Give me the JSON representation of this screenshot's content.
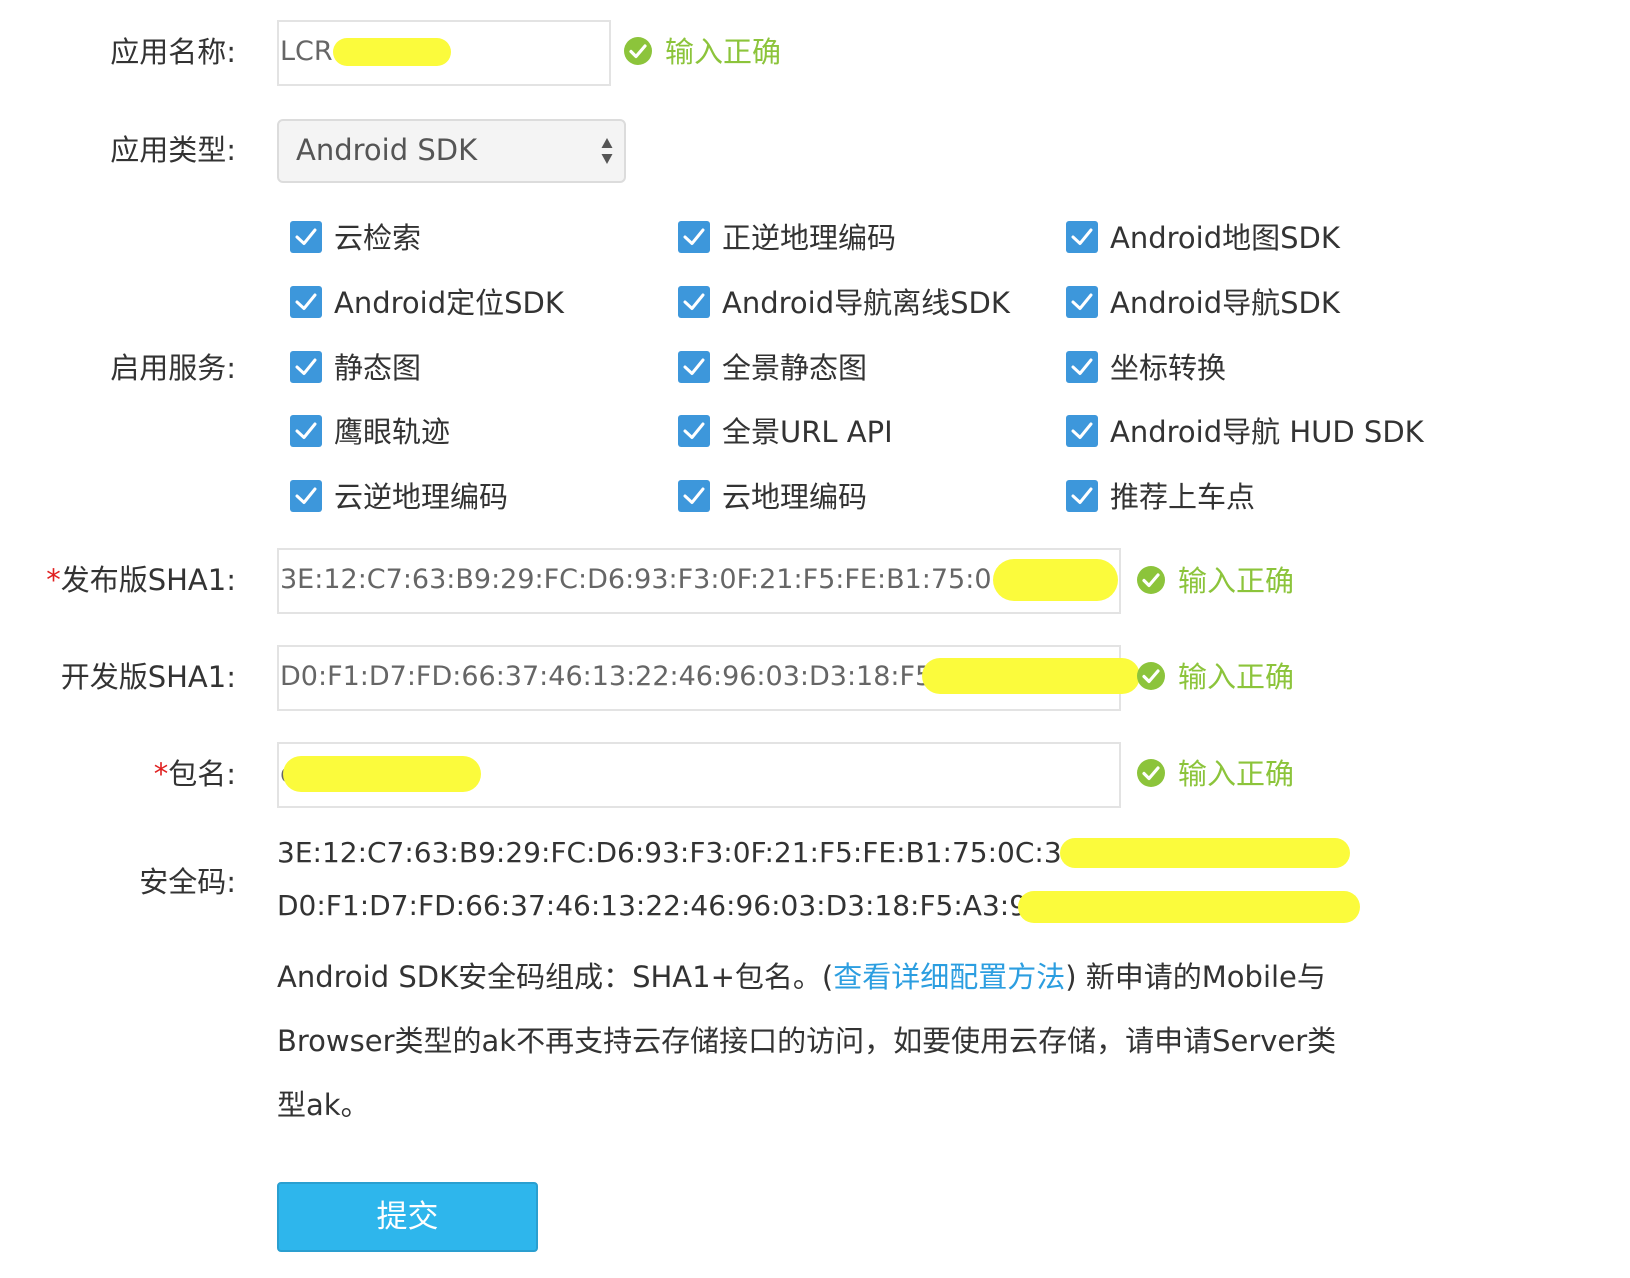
{
  "form": {
    "app_name_label": "应用名称:",
    "app_name_value": "LCR",
    "app_type_label": "应用类型:",
    "app_type_value": "Android SDK",
    "services_label": "启用服务:",
    "release_sha1_required": "*",
    "release_sha1_label": "发布版SHA1:",
    "release_sha1_value": "3E:12:C7:63:B9:29:FC:D6:93:F3:0F:21:F5:FE:B1:75:0",
    "dev_sha1_label": "开发版SHA1:",
    "dev_sha1_value": "D0:F1:D7:FD:66:37:46:13:22:46:96:03:D3:18:F5:",
    "package_required": "*",
    "package_label": "包名:",
    "package_value": "c",
    "valid_text": "输入正确"
  },
  "services": [
    "云检索",
    "正逆地理编码",
    "Android地图SDK",
    "Android定位SDK",
    "Android导航离线SDK",
    "Android导航SDK",
    "静态图",
    "全景静态图",
    "坐标转换",
    "鹰眼轨迹",
    "全景URL API",
    "Android导航 HUD SDK",
    "云逆地理编码",
    "云地理编码",
    "推荐上车点"
  ],
  "security": {
    "label": "安全码:",
    "line1": "3E:12:C7:63:B9:29:FC:D6:93:F3:0F:21:F5:FE:B1:75:0C:36.",
    "line2": "D0:F1:D7:FD:66:37:46:13:22:46:96:03:D3:18:F5:A3:95:",
    "desc_part1": "Android SDK安全码组成：SHA1+包名。(",
    "desc_link": "查看详细配置方法",
    "desc_part2": ") 新申请的Mobile与Browser类型的ak不再支持云存储接口的访问，如要使用云存储，请申请Server类型ak。"
  },
  "submit_label": "提交",
  "colors": {
    "valid": "#8cc43b",
    "checkbox": "#3d97db",
    "link": "#2c9ee0",
    "submit": "#2eb6ec",
    "required": "#e02020",
    "redaction": "#fbfb3c"
  }
}
